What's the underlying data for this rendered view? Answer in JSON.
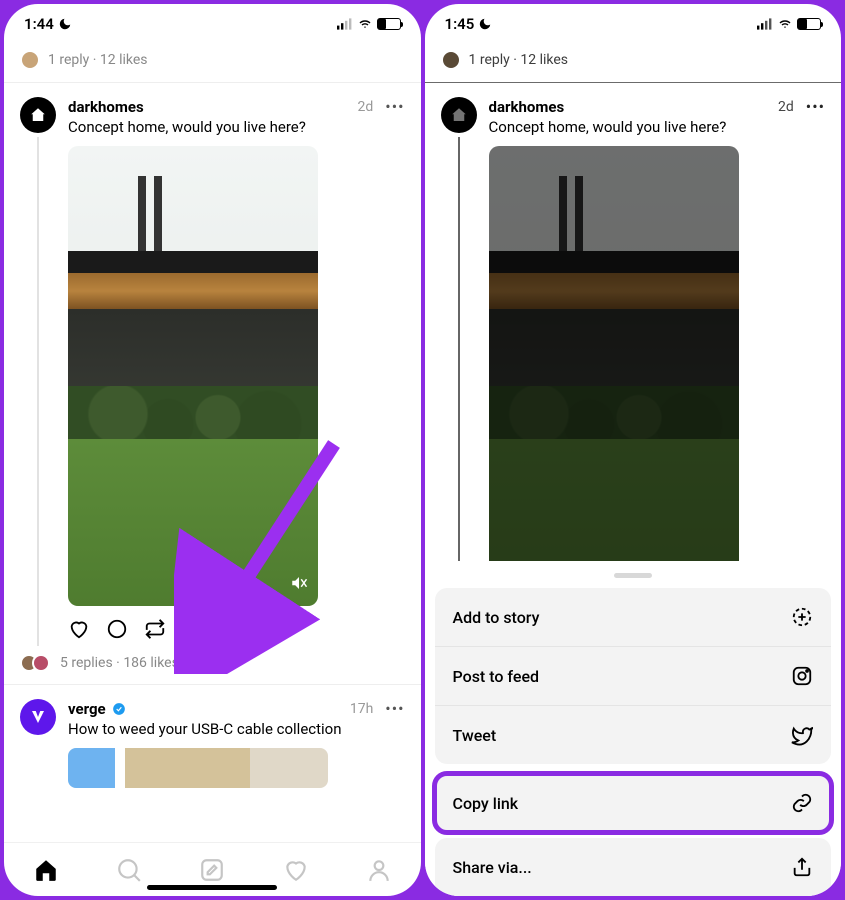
{
  "left": {
    "status": {
      "time": "1:44"
    },
    "top_reply": {
      "replies": "1 reply",
      "likes": "12 likes",
      "sep": " · "
    },
    "post": {
      "username": "darkhomes",
      "time": "2d",
      "text": "Concept home, would you live here?"
    },
    "post_meta": {
      "replies": "5 replies",
      "likes": "186 likes",
      "sep": " · "
    },
    "post2": {
      "username": "verge",
      "time": "17h",
      "text": "How to weed your USB-C cable collection"
    }
  },
  "right": {
    "status": {
      "time": "1:45"
    },
    "top_reply": {
      "replies": "1 reply",
      "likes": "12 likes",
      "sep": " · "
    },
    "post": {
      "username": "darkhomes",
      "time": "2d",
      "text": "Concept home, would you live here?"
    },
    "sheet": {
      "add_to_story": "Add to story",
      "post_to_feed": "Post to feed",
      "tweet": "Tweet",
      "copy_link": "Copy link",
      "share_via": "Share via..."
    }
  }
}
